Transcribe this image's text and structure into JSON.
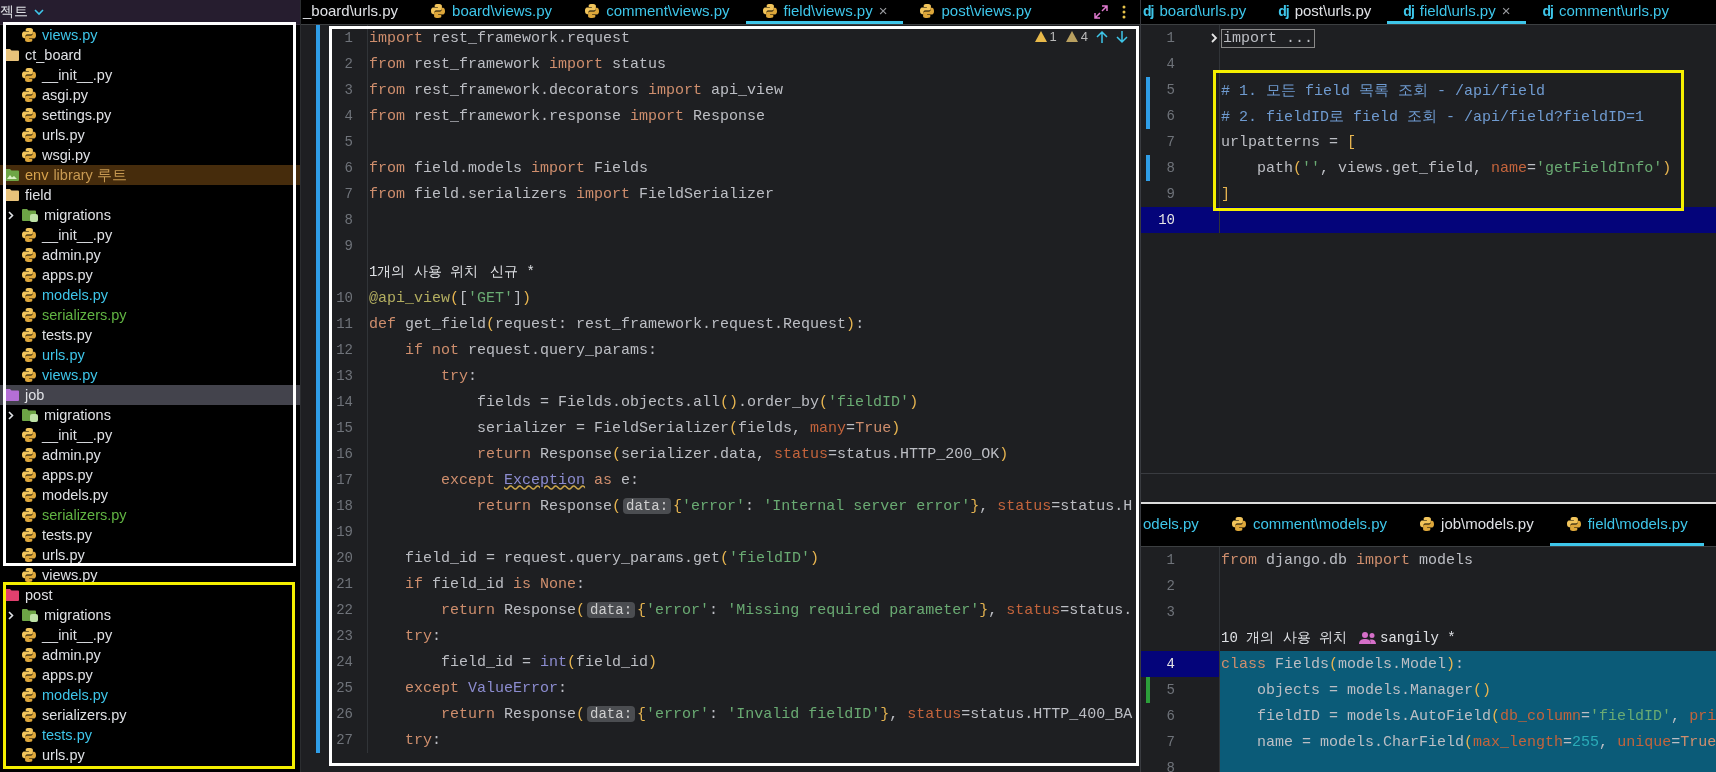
{
  "sidebar": {
    "header": {
      "title": "젝트"
    },
    "highlight_boxes": [
      {
        "color": "#ffffff"
      },
      {
        "color": "#f5ef00"
      }
    ],
    "tree": {
      "continued_children": [
        {
          "kind": "file",
          "name": "views.py",
          "modified": true,
          "added": false,
          "selected": false
        }
      ],
      "items": [
        {
          "kind": "folder",
          "name": "ct_board",
          "color": "#e8c27a",
          "selected": false,
          "children": [
            {
              "kind": "file",
              "name": "__init__.py",
              "modified": false,
              "added": false,
              "selected": false
            },
            {
              "kind": "file",
              "name": "asgi.py",
              "modified": false,
              "added": false,
              "selected": false
            },
            {
              "kind": "file",
              "name": "settings.py",
              "modified": false,
              "added": false,
              "selected": false
            },
            {
              "kind": "file",
              "name": "urls.py",
              "modified": false,
              "added": false,
              "selected": false
            },
            {
              "kind": "file",
              "name": "wsgi.py",
              "modified": false,
              "added": false,
              "selected": false
            }
          ]
        },
        {
          "kind": "library",
          "name": "env",
          "suffix": "library 루트",
          "selected": false
        },
        {
          "kind": "folder",
          "name": "field",
          "color": "#e8c27a",
          "selected": false,
          "children": [
            {
              "kind": "db-folder",
              "name": "migrations",
              "expanded": false,
              "selected": false
            },
            {
              "kind": "file",
              "name": "__init__.py",
              "modified": false,
              "added": false,
              "selected": false
            },
            {
              "kind": "file",
              "name": "admin.py",
              "modified": false,
              "added": false,
              "selected": false
            },
            {
              "kind": "file",
              "name": "apps.py",
              "modified": false,
              "added": false,
              "selected": false
            },
            {
              "kind": "file",
              "name": "models.py",
              "modified": true,
              "added": false,
              "selected": false
            },
            {
              "kind": "file",
              "name": "serializers.py",
              "modified": false,
              "added": true,
              "selected": false
            },
            {
              "kind": "file",
              "name": "tests.py",
              "modified": false,
              "added": false,
              "selected": false
            },
            {
              "kind": "file",
              "name": "urls.py",
              "modified": true,
              "added": false,
              "selected": false
            },
            {
              "kind": "file",
              "name": "views.py",
              "modified": true,
              "added": false,
              "selected": false
            }
          ]
        },
        {
          "kind": "folder",
          "name": "job",
          "color": "#b46fd6",
          "selected": true,
          "children": [
            {
              "kind": "db-folder",
              "name": "migrations",
              "expanded": false,
              "selected": false
            },
            {
              "kind": "file",
              "name": "__init__.py",
              "modified": false,
              "added": false,
              "selected": false
            },
            {
              "kind": "file",
              "name": "admin.py",
              "modified": false,
              "added": false,
              "selected": false
            },
            {
              "kind": "file",
              "name": "apps.py",
              "modified": false,
              "added": false,
              "selected": false
            },
            {
              "kind": "file",
              "name": "models.py",
              "modified": false,
              "added": false,
              "selected": false
            },
            {
              "kind": "file",
              "name": "serializers.py",
              "modified": false,
              "added": true,
              "selected": false
            },
            {
              "kind": "file",
              "name": "tests.py",
              "modified": false,
              "added": false,
              "selected": false
            },
            {
              "kind": "file",
              "name": "urls.py",
              "modified": false,
              "added": false,
              "selected": false
            },
            {
              "kind": "file",
              "name": "views.py",
              "modified": false,
              "added": false,
              "selected": false
            }
          ]
        },
        {
          "kind": "folder",
          "name": "post",
          "color": "#e0406e",
          "selected": false,
          "children": [
            {
              "kind": "db-folder",
              "name": "migrations",
              "expanded": false,
              "selected": false
            },
            {
              "kind": "file",
              "name": "__init__.py",
              "modified": false,
              "added": false,
              "selected": false
            },
            {
              "kind": "file",
              "name": "admin.py",
              "modified": false,
              "added": false,
              "selected": false
            },
            {
              "kind": "file",
              "name": "apps.py",
              "modified": false,
              "added": false,
              "selected": false
            },
            {
              "kind": "file",
              "name": "models.py",
              "modified": true,
              "added": false,
              "selected": false
            },
            {
              "kind": "file",
              "name": "serializers.py",
              "modified": false,
              "added": false,
              "selected": false
            },
            {
              "kind": "file",
              "name": "tests.py",
              "modified": true,
              "added": false,
              "selected": false
            },
            {
              "kind": "file",
              "name": "urls.py",
              "modified": false,
              "added": false,
              "selected": false
            }
          ]
        }
      ]
    }
  },
  "editor": {
    "tabs": [
      {
        "kind": "plain",
        "label": "_board\\urls.py",
        "modified": false,
        "selected": false
      },
      {
        "kind": "python",
        "label": "board\\views.py",
        "modified": true,
        "selected": false
      },
      {
        "kind": "python",
        "label": "comment\\views.py",
        "modified": true,
        "selected": false
      },
      {
        "kind": "python",
        "label": "field\\views.py",
        "modified": true,
        "selected": true,
        "close": "×"
      },
      {
        "kind": "python",
        "label": "post\\views.py",
        "modified": true,
        "selected": false
      }
    ],
    "inspections": [
      {
        "kind": "warning",
        "count": "1"
      },
      {
        "kind": "weak_warning",
        "count": "4"
      }
    ],
    "highlight_boxes": [
      {
        "color": "#ffffff"
      }
    ],
    "lines": [
      {
        "kind": "code",
        "number": "1",
        "modified": true,
        "tokens": [
          {
            "kind": "kw",
            "text": "import"
          },
          {
            "kind": "plain",
            "text": " rest_framework.request"
          }
        ]
      },
      {
        "kind": "code",
        "number": "2",
        "modified": true,
        "tokens": [
          {
            "kind": "kw",
            "text": "from"
          },
          {
            "kind": "plain",
            "text": " rest_framework "
          },
          {
            "kind": "kw",
            "text": "import"
          },
          {
            "kind": "plain",
            "text": " status"
          }
        ]
      },
      {
        "kind": "code",
        "number": "3",
        "modified": true,
        "tokens": [
          {
            "kind": "kw",
            "text": "from"
          },
          {
            "kind": "plain",
            "text": " rest_framework.decorators "
          },
          {
            "kind": "kw",
            "text": "import"
          },
          {
            "kind": "plain",
            "text": " api_view"
          }
        ]
      },
      {
        "kind": "code",
        "number": "4",
        "modified": true,
        "tokens": [
          {
            "kind": "kw",
            "text": "from"
          },
          {
            "kind": "plain",
            "text": " rest_framework.response "
          },
          {
            "kind": "kw",
            "text": "import"
          },
          {
            "kind": "plain",
            "text": " Response"
          }
        ]
      },
      {
        "kind": "code",
        "number": "5",
        "modified": true
      },
      {
        "kind": "code",
        "number": "6",
        "modified": true,
        "tokens": [
          {
            "kind": "kw",
            "text": "from"
          },
          {
            "kind": "plain",
            "text": " field.models "
          },
          {
            "kind": "kw",
            "text": "import"
          },
          {
            "kind": "plain",
            "text": " Fields"
          }
        ]
      },
      {
        "kind": "code",
        "number": "7",
        "modified": true,
        "tokens": [
          {
            "kind": "kw",
            "text": "from"
          },
          {
            "kind": "plain",
            "text": " field.serializers "
          },
          {
            "kind": "kw",
            "text": "import"
          },
          {
            "kind": "plain",
            "text": " FieldSerializer"
          }
        ]
      },
      {
        "kind": "code",
        "number": "8",
        "modified": true
      },
      {
        "kind": "code",
        "number": "9",
        "modified": true
      },
      {
        "kind": "usages",
        "modified": true,
        "text": "1개의 사용 위치",
        "note": "신규 *",
        "note_icon": false
      },
      {
        "kind": "code",
        "number": "10",
        "modified": true,
        "tokens": [
          {
            "kind": "deco",
            "text": "@api_view"
          },
          {
            "kind": "bracket",
            "text": "("
          },
          {
            "kind": "plain",
            "text": "["
          },
          {
            "kind": "str",
            "text": "'GET'"
          },
          {
            "kind": "plain",
            "text": "]"
          },
          {
            "kind": "bracket",
            "text": ")"
          }
        ]
      },
      {
        "kind": "code",
        "number": "11",
        "modified": true,
        "tokens": [
          {
            "kind": "kw",
            "text": "def"
          },
          {
            "kind": "plain",
            "text": " get_field"
          },
          {
            "kind": "bracket",
            "text": "("
          },
          {
            "kind": "plain",
            "text": "request: rest_framework.request.Request"
          },
          {
            "kind": "bracket",
            "text": ")"
          },
          {
            "kind": "plain",
            "text": ":"
          }
        ]
      },
      {
        "kind": "code",
        "number": "12",
        "modified": true,
        "tokens": [
          {
            "kind": "kw",
            "text": "    if not"
          },
          {
            "kind": "plain",
            "text": " request.query_params:"
          }
        ]
      },
      {
        "kind": "code",
        "number": "13",
        "modified": true,
        "tokens": [
          {
            "kind": "kw",
            "text": "        try"
          },
          {
            "kind": "plain",
            "text": ":"
          }
        ]
      },
      {
        "kind": "code",
        "number": "14",
        "modified": true,
        "tokens": [
          {
            "kind": "plain",
            "text": "            fields = Fields.objects.all"
          },
          {
            "kind": "bracket",
            "text": "()"
          },
          {
            "kind": "plain",
            "text": ".order_by"
          },
          {
            "kind": "bracket",
            "text": "("
          },
          {
            "kind": "str",
            "text": "'fieldID'"
          },
          {
            "kind": "bracket",
            "text": ")"
          }
        ]
      },
      {
        "kind": "code",
        "number": "15",
        "modified": true,
        "tokens": [
          {
            "kind": "plain",
            "text": "            serializer = FieldSerializer"
          },
          {
            "kind": "bracket",
            "text": "("
          },
          {
            "kind": "plain",
            "text": "fields, "
          },
          {
            "kind": "param",
            "text": "many"
          },
          {
            "kind": "plain",
            "text": "="
          },
          {
            "kind": "kw",
            "text": "True"
          },
          {
            "kind": "bracket",
            "text": ")"
          }
        ]
      },
      {
        "kind": "code",
        "number": "16",
        "modified": true,
        "tokens": [
          {
            "kind": "kw",
            "text": "            return"
          },
          {
            "kind": "plain",
            "text": " Response"
          },
          {
            "kind": "bracket",
            "text": "("
          },
          {
            "kind": "plain",
            "text": "serializer.data, "
          },
          {
            "kind": "param",
            "text": "status"
          },
          {
            "kind": "plain",
            "text": "=status.HTTP_200_OK"
          },
          {
            "kind": "bracket",
            "text": ")"
          }
        ]
      },
      {
        "kind": "code",
        "number": "17",
        "modified": true,
        "tokens": [
          {
            "kind": "kw",
            "text": "        except "
          },
          {
            "kind": "warn",
            "text": "Exception"
          },
          {
            "kind": "kw",
            "text": " as"
          },
          {
            "kind": "plain",
            "text": " e:"
          }
        ]
      },
      {
        "kind": "code",
        "number": "18",
        "modified": true,
        "tokens": [
          {
            "kind": "kw",
            "text": "            return"
          },
          {
            "kind": "plain",
            "text": " Response"
          },
          {
            "kind": "bracket",
            "text": "("
          },
          {
            "kind": "hint",
            "text": "data:"
          },
          {
            "kind": "bracket",
            "text": "{"
          },
          {
            "kind": "str",
            "text": "'error'"
          },
          {
            "kind": "plain",
            "text": ": "
          },
          {
            "kind": "str",
            "text": "'Internal server error'"
          },
          {
            "kind": "bracket",
            "text": "}"
          },
          {
            "kind": "plain",
            "text": ", "
          },
          {
            "kind": "param",
            "text": "status"
          },
          {
            "kind": "plain",
            "text": "=status.H"
          }
        ]
      },
      {
        "kind": "code",
        "number": "19",
        "modified": true
      },
      {
        "kind": "code",
        "number": "20",
        "modified": true,
        "tokens": [
          {
            "kind": "plain",
            "text": "    field_id = request.query_params.get"
          },
          {
            "kind": "bracket",
            "text": "("
          },
          {
            "kind": "str",
            "text": "'fieldID'"
          },
          {
            "kind": "bracket",
            "text": ")"
          }
        ]
      },
      {
        "kind": "code",
        "number": "21",
        "modified": true,
        "tokens": [
          {
            "kind": "kw",
            "text": "    if"
          },
          {
            "kind": "plain",
            "text": " field_id "
          },
          {
            "kind": "kw",
            "text": "is None"
          },
          {
            "kind": "plain",
            "text": ":"
          }
        ]
      },
      {
        "kind": "code",
        "number": "22",
        "modified": true,
        "tokens": [
          {
            "kind": "kw",
            "text": "        return"
          },
          {
            "kind": "plain",
            "text": " Response"
          },
          {
            "kind": "bracket",
            "text": "("
          },
          {
            "kind": "hint",
            "text": "data:"
          },
          {
            "kind": "bracket",
            "text": "{"
          },
          {
            "kind": "str",
            "text": "'error'"
          },
          {
            "kind": "plain",
            "text": ": "
          },
          {
            "kind": "str",
            "text": "'Missing required parameter'"
          },
          {
            "kind": "bracket",
            "text": "}"
          },
          {
            "kind": "plain",
            "text": ", "
          },
          {
            "kind": "param",
            "text": "status"
          },
          {
            "kind": "plain",
            "text": "=status."
          }
        ]
      },
      {
        "kind": "code",
        "number": "23",
        "modified": true,
        "tokens": [
          {
            "kind": "kw",
            "text": "    try"
          },
          {
            "kind": "plain",
            "text": ":"
          }
        ]
      },
      {
        "kind": "code",
        "number": "24",
        "modified": true,
        "tokens": [
          {
            "kind": "plain",
            "text": "        field_id = "
          },
          {
            "kind": "builtin",
            "text": "int"
          },
          {
            "kind": "bracket",
            "text": "("
          },
          {
            "kind": "plain",
            "text": "field_id"
          },
          {
            "kind": "bracket",
            "text": ")"
          }
        ]
      },
      {
        "kind": "code",
        "number": "25",
        "modified": true,
        "tokens": [
          {
            "kind": "kw",
            "text": "    except "
          },
          {
            "kind": "builtin",
            "text": "ValueError"
          },
          {
            "kind": "plain",
            "text": ":"
          }
        ]
      },
      {
        "kind": "code",
        "number": "26",
        "modified": true,
        "tokens": [
          {
            "kind": "kw",
            "text": "        return"
          },
          {
            "kind": "plain",
            "text": " Response"
          },
          {
            "kind": "bracket",
            "text": "("
          },
          {
            "kind": "hint",
            "text": "data:"
          },
          {
            "kind": "bracket",
            "text": "{"
          },
          {
            "kind": "str",
            "text": "'error'"
          },
          {
            "kind": "plain",
            "text": ": "
          },
          {
            "kind": "str",
            "text": "'Invalid fieldID'"
          },
          {
            "kind": "bracket",
            "text": "}"
          },
          {
            "kind": "plain",
            "text": ", "
          },
          {
            "kind": "param",
            "text": "status"
          },
          {
            "kind": "plain",
            "text": "=status.HTTP_400_BA"
          }
        ]
      },
      {
        "kind": "code",
        "number": "27",
        "modified": true,
        "tokens": [
          {
            "kind": "kw",
            "text": "    try"
          },
          {
            "kind": "plain",
            "text": ":"
          }
        ]
      }
    ]
  },
  "right_top": {
    "tabs": [
      {
        "kind": "django",
        "glyph": "dj",
        "label": "board\\urls.py",
        "modified": true,
        "selected": false
      },
      {
        "kind": "django",
        "glyph": "dj",
        "label": "post\\urls.py",
        "modified": false,
        "selected": false
      },
      {
        "kind": "django",
        "glyph": "dj",
        "label": "field\\urls.py",
        "modified": true,
        "selected": true,
        "close": "×"
      },
      {
        "kind": "django",
        "glyph": "dj",
        "label": "comment\\urls.py",
        "modified": true,
        "selected": false
      }
    ],
    "highlight_boxes": [
      {
        "color": "#f5ef00"
      }
    ],
    "lines": [
      {
        "kind": "code",
        "number": "1",
        "folded": true,
        "tokens": [
          {
            "kind": "plain",
            "text": "import ..."
          }
        ]
      },
      {
        "kind": "code",
        "number": "4"
      },
      {
        "kind": "code",
        "number": "5",
        "modified": true,
        "tokens": [
          {
            "kind": "comment",
            "text": "# 1. 모든 field 목록 조회 - /api/field"
          }
        ]
      },
      {
        "kind": "code",
        "number": "6",
        "modified": true,
        "tokens": [
          {
            "kind": "comment",
            "text": "# 2. fieldID로 field 조회 - /api/field?fieldID=1"
          }
        ]
      },
      {
        "kind": "code",
        "number": "7",
        "tokens": [
          {
            "kind": "plain",
            "text": "urlpatterns = "
          },
          {
            "kind": "bracket",
            "text": "["
          }
        ]
      },
      {
        "kind": "code",
        "number": "8",
        "modified": true,
        "tokens": [
          {
            "kind": "plain",
            "text": "    path"
          },
          {
            "kind": "bracket",
            "text": "("
          },
          {
            "kind": "str",
            "text": "''"
          },
          {
            "kind": "plain",
            "text": ", views.get_field, "
          },
          {
            "kind": "param",
            "text": "name"
          },
          {
            "kind": "plain",
            "text": "="
          },
          {
            "kind": "str",
            "text": "'getFieldInfo'"
          },
          {
            "kind": "bracket",
            "text": ")"
          }
        ]
      },
      {
        "kind": "code",
        "number": "9",
        "tokens": [
          {
            "kind": "bracket",
            "text": "]"
          }
        ]
      },
      {
        "kind": "code",
        "number": "10",
        "current": true
      }
    ]
  },
  "right_bottom": {
    "tabs": [
      {
        "kind": "plain",
        "label": "odels.py",
        "modified": true,
        "selected": false
      },
      {
        "kind": "python",
        "label": "comment\\models.py",
        "modified": true,
        "selected": false
      },
      {
        "kind": "python",
        "label": "job\\models.py",
        "modified": false,
        "selected": false
      },
      {
        "kind": "python",
        "label": "field\\models.py",
        "modified": true,
        "selected": true
      }
    ],
    "lines": [
      {
        "kind": "code",
        "number": "1",
        "tokens": [
          {
            "kind": "kw",
            "text": "from"
          },
          {
            "kind": "plain",
            "text": " django.db "
          },
          {
            "kind": "kw",
            "text": "import"
          },
          {
            "kind": "plain",
            "text": " models"
          }
        ]
      },
      {
        "kind": "code",
        "number": "2"
      },
      {
        "kind": "code",
        "number": "3"
      },
      {
        "kind": "usages",
        "text": "10 개의 사용 위치",
        "note": "sangily *",
        "note_icon": true
      },
      {
        "kind": "code",
        "number": "4",
        "current": true,
        "selected": true,
        "tokens": [
          {
            "kind": "kw",
            "text": "class"
          },
          {
            "kind": "plain",
            "text": " Fields"
          },
          {
            "kind": "bracket",
            "text": "("
          },
          {
            "kind": "plain",
            "text": "models.Model"
          },
          {
            "kind": "bracket",
            "text": ")"
          },
          {
            "kind": "plain",
            "text": ":"
          }
        ]
      },
      {
        "kind": "code",
        "number": "5",
        "added": true,
        "selected": true,
        "tokens": [
          {
            "kind": "plain",
            "text": "    objects = models.Manager"
          },
          {
            "kind": "bracket",
            "text": "()"
          }
        ]
      },
      {
        "kind": "code",
        "number": "6",
        "selected": true,
        "tokens": [
          {
            "kind": "plain",
            "text": "    fieldID = models.AutoField"
          },
          {
            "kind": "bracket",
            "text": "("
          },
          {
            "kind": "param",
            "text": "db_column"
          },
          {
            "kind": "plain",
            "text": "="
          },
          {
            "kind": "str",
            "text": "'fieldID'"
          },
          {
            "kind": "plain",
            "text": ", "
          },
          {
            "kind": "param",
            "text": "pri"
          }
        ]
      },
      {
        "kind": "code",
        "number": "7",
        "selected": true,
        "tokens": [
          {
            "kind": "plain",
            "text": "    name = models.CharField"
          },
          {
            "kind": "bracket",
            "text": "("
          },
          {
            "kind": "param",
            "text": "max_length"
          },
          {
            "kind": "plain",
            "text": "="
          },
          {
            "kind": "num",
            "text": "255"
          },
          {
            "kind": "plain",
            "text": ", "
          },
          {
            "kind": "param",
            "text": "unique"
          },
          {
            "kind": "plain",
            "text": "="
          },
          {
            "kind": "kw",
            "text": "True"
          }
        ]
      },
      {
        "kind": "code",
        "number": "8",
        "selected": true
      }
    ]
  }
}
